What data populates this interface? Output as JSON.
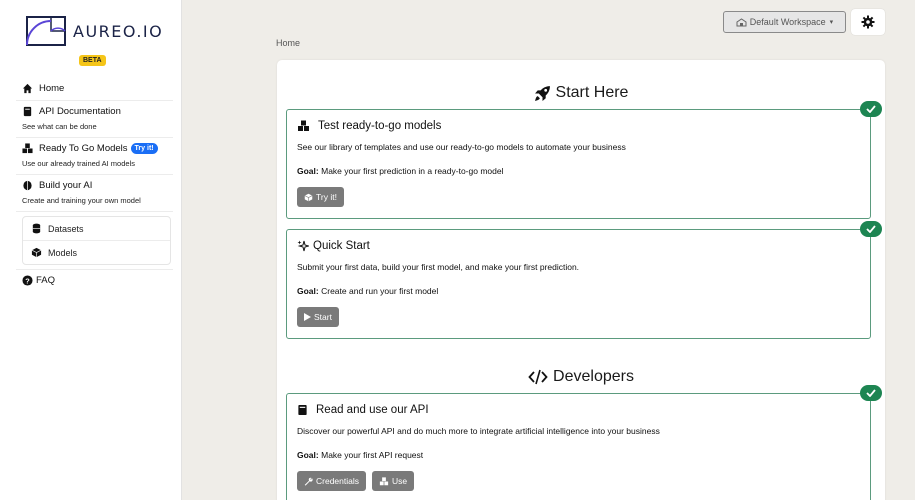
{
  "brand": {
    "name": "AUREO.IO",
    "badge": "BETA"
  },
  "nav": {
    "home": "Home",
    "api_docs": {
      "label": "API Documentation",
      "sub": "See what can be done"
    },
    "ready": {
      "label": "Ready To Go Models",
      "badge": "Try it!",
      "sub": "Use our already trained AI models"
    },
    "build": {
      "label": "Build your AI",
      "sub": "Create and training your own model"
    },
    "datasets": "Datasets",
    "models": "Models",
    "faq": "FAQ"
  },
  "topbar": {
    "workspace": "Default Workspace",
    "workspace_caret": "▾"
  },
  "breadcrumb": "Home",
  "sections": {
    "start": "Start Here",
    "developers": "Developers"
  },
  "steps": {
    "test": {
      "title": "Test ready-to-go models",
      "desc": "See our library of templates and use our ready-to-go models to automate your business",
      "goal_label": "Goal:",
      "goal": "Make your first prediction in a ready-to-go model",
      "button": "Try it!"
    },
    "quick": {
      "title": "Quick Start",
      "desc": "Submit your first data, build your first model, and make your first prediction.",
      "goal_label": "Goal:",
      "goal": "Create and run your first model",
      "button": "Start"
    },
    "api": {
      "title": "Read and use our API",
      "desc": "Discover our powerful API and do much more to integrate artificial intelligence into your business",
      "goal_label": "Goal:",
      "goal": "Make your first API request",
      "button_credentials": "Credentials",
      "button_use": "Use"
    }
  },
  "colors": {
    "accent": "#1d8552",
    "border": "#5b9b7e",
    "button": "#7a7a7a",
    "badge": "#f5c518",
    "tryit": "#1a6ef5"
  }
}
